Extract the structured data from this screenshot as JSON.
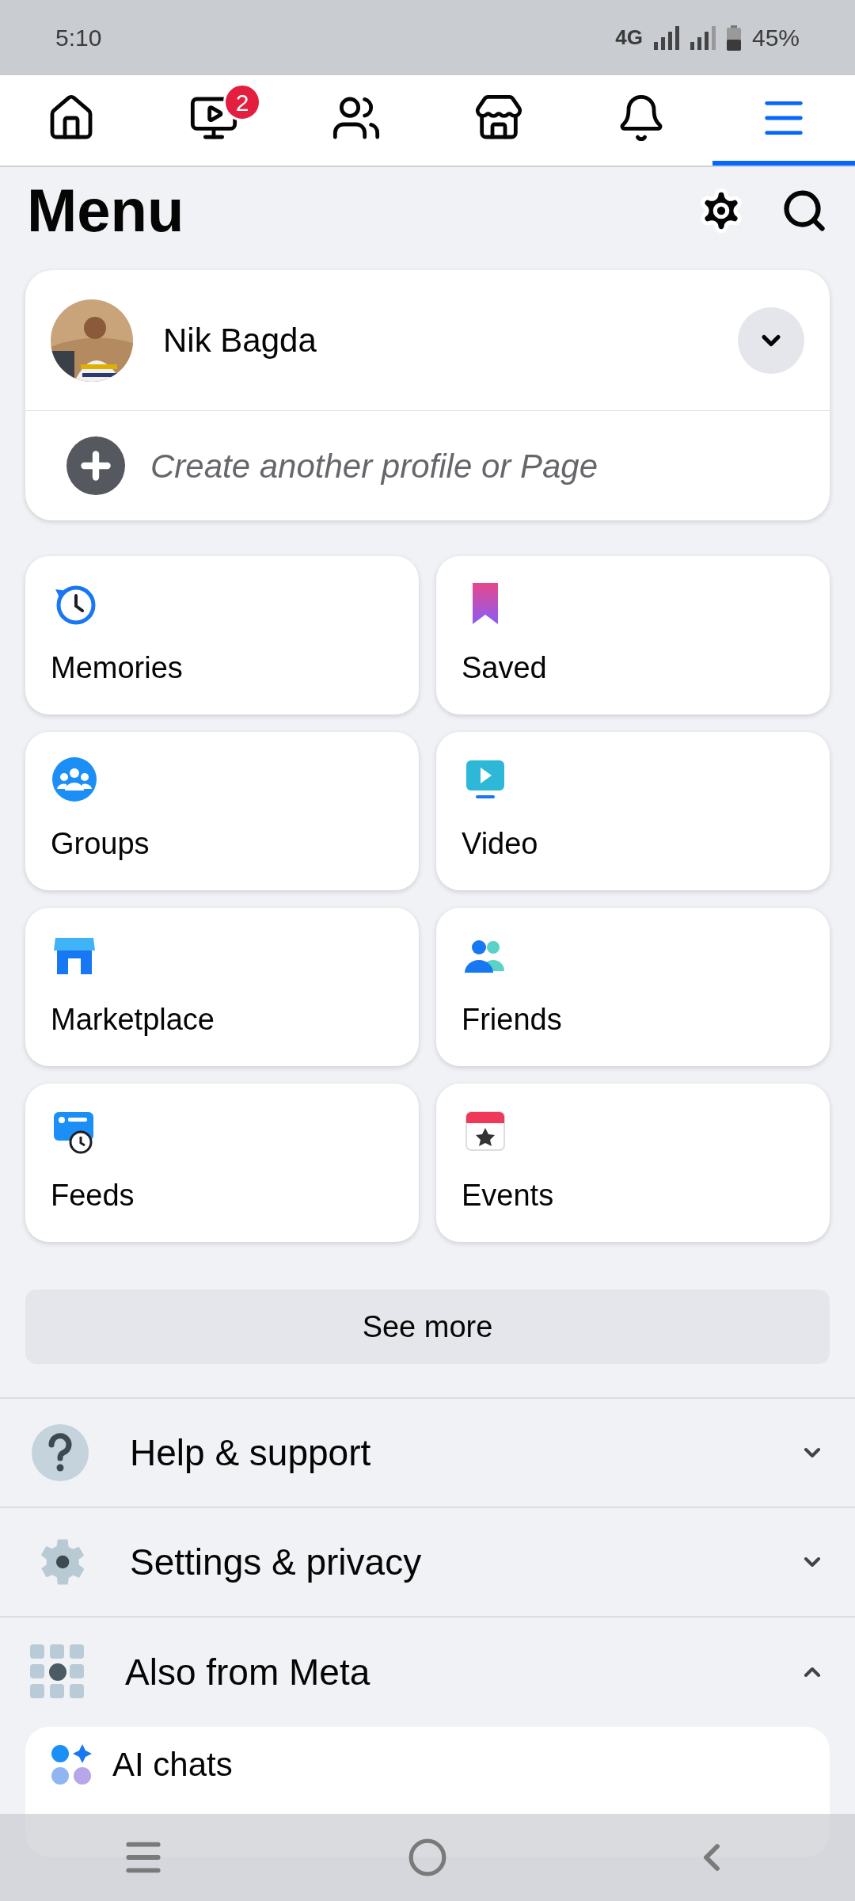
{
  "status_bar": {
    "time": "5:10",
    "network": "4G",
    "battery": "45%"
  },
  "tabs": [
    {
      "kind": "home",
      "selected": false
    },
    {
      "kind": "video",
      "selected": false,
      "badge": "2"
    },
    {
      "kind": "friends",
      "selected": false
    },
    {
      "kind": "marketplace",
      "selected": false
    },
    {
      "kind": "notifications",
      "selected": false
    },
    {
      "kind": "menu",
      "selected": true
    }
  ],
  "header": {
    "title": "Menu"
  },
  "profile": {
    "name": "Nik Bagda",
    "create": "Create another profile or Page"
  },
  "shortcuts": [
    {
      "label": "Memories",
      "kind": "memories"
    },
    {
      "label": "Saved",
      "kind": "saved"
    },
    {
      "label": "Groups",
      "kind": "groups"
    },
    {
      "label": "Video",
      "kind": "video"
    },
    {
      "label": "Marketplace",
      "kind": "marketplace"
    },
    {
      "label": "Friends",
      "kind": "friends"
    },
    {
      "label": "Feeds",
      "kind": "feeds"
    },
    {
      "label": "Events",
      "kind": "events"
    }
  ],
  "see_more": "See more",
  "sections": [
    {
      "label": "Help & support",
      "kind": "help",
      "expanded": false
    },
    {
      "label": "Settings & privacy",
      "kind": "settings",
      "expanded": false
    },
    {
      "label": "Also from Meta",
      "kind": "apps",
      "expanded": true,
      "children": [
        {
          "label": "AI chats",
          "kind": "ai"
        }
      ]
    }
  ]
}
